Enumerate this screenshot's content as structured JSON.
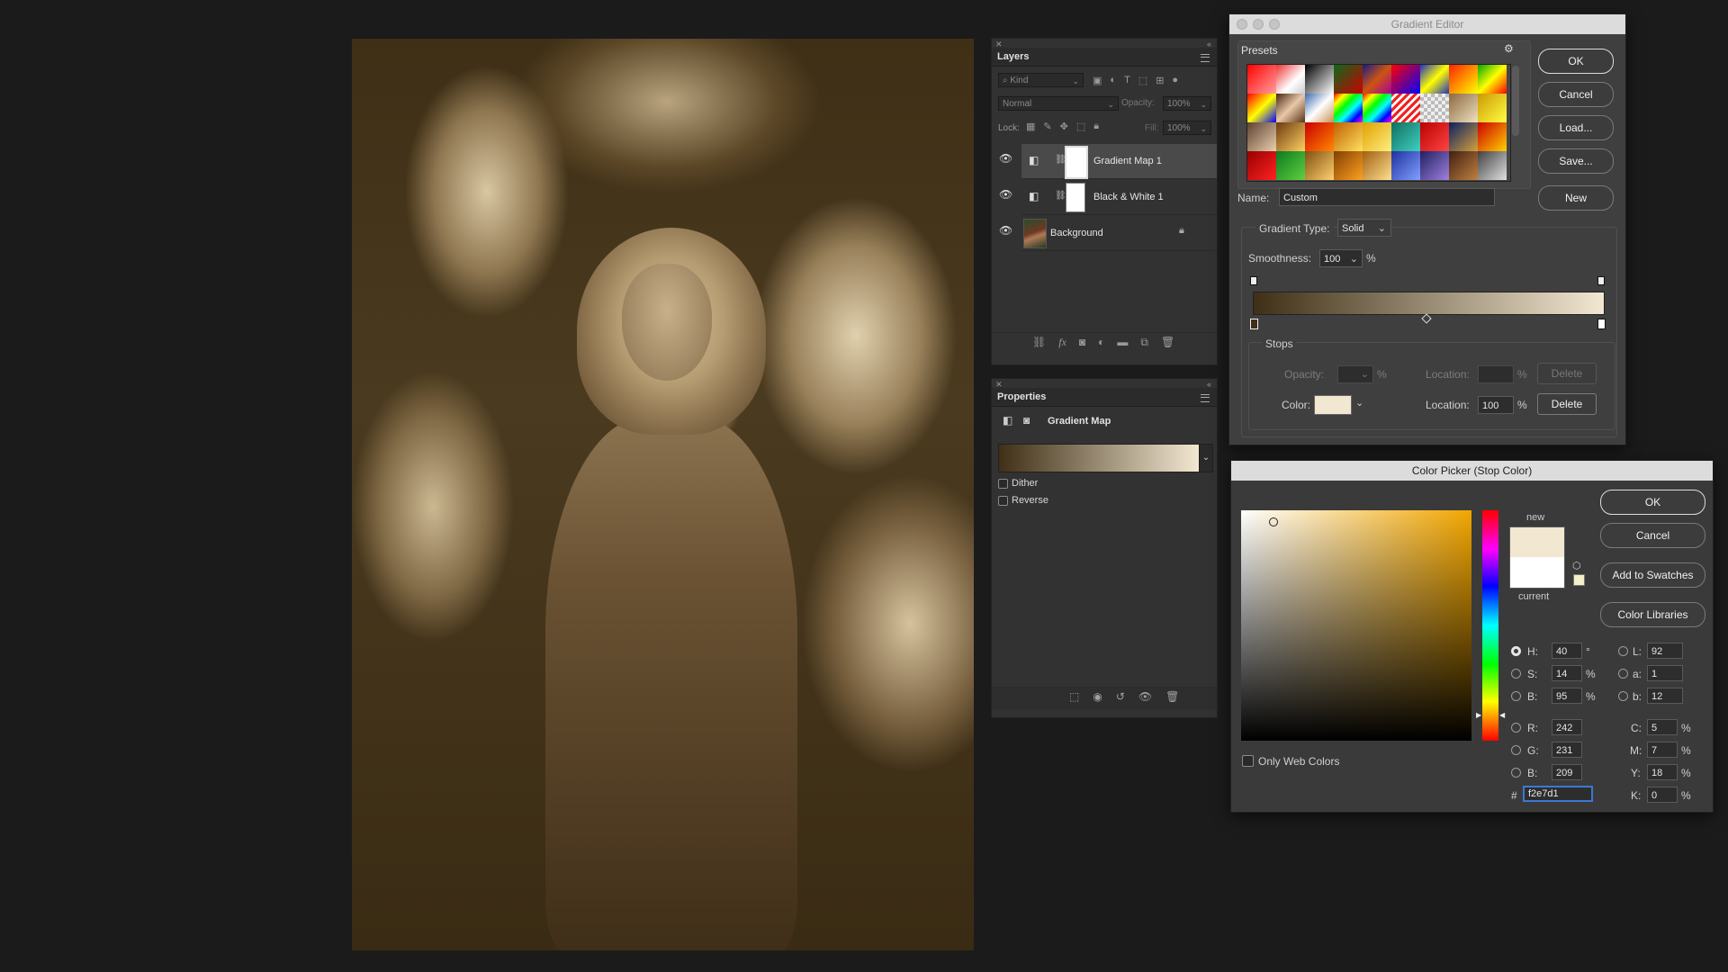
{
  "layers_panel": {
    "title": "Layers",
    "kind_label": "Kind",
    "blend_mode": "Normal",
    "opacity_label": "Opacity:",
    "opacity_value": "100%",
    "lock_label": "Lock:",
    "fill_label": "Fill:",
    "fill_value": "100%",
    "layers": [
      {
        "name": "Gradient Map 1",
        "selected": true
      },
      {
        "name": "Black & White 1",
        "selected": false
      },
      {
        "name": "Background",
        "selected": false
      }
    ],
    "footer_icons": [
      "link-icon",
      "fx-icon",
      "mask-icon",
      "adjustment-icon",
      "folder-icon",
      "new-layer-icon",
      "trash-icon"
    ]
  },
  "properties_panel": {
    "title": "Properties",
    "adjustment_title": "Gradient Map",
    "dither_label": "Dither",
    "reverse_label": "Reverse",
    "gradient_start": "#3f2f16",
    "gradient_end": "#f2e7d1"
  },
  "gradient_editor": {
    "window_title": "Gradient Editor",
    "presets_label": "Presets",
    "buttons": {
      "ok": "OK",
      "cancel": "Cancel",
      "load": "Load...",
      "save": "Save...",
      "new": "New"
    },
    "name_label": "Name:",
    "name_value": "Custom",
    "gradient_type_label": "Gradient Type:",
    "gradient_type_value": "Solid",
    "smoothness_label": "Smoothness:",
    "smoothness_value": "100",
    "percent": "%",
    "stops_label": "Stops",
    "opacity_label": "Opacity:",
    "location_label": "Location:",
    "color_label": "Color:",
    "location_value": "100",
    "delete_label": "Delete",
    "stop_color": "#f2e7d1",
    "gradient_start": "#3f2f16",
    "gradient_end": "#f2e7d1"
  },
  "color_picker": {
    "window_title": "Color Picker (Stop Color)",
    "buttons": {
      "ok": "OK",
      "cancel": "Cancel",
      "add_swatches": "Add to Swatches",
      "libraries": "Color Libraries"
    },
    "new_label": "new",
    "current_label": "current",
    "new_color": "#f2e7d1",
    "current_color": "#ffffff",
    "only_web_label": "Only Web Colors",
    "hsb": {
      "h_label": "H:",
      "h": "40",
      "h_unit": "°",
      "s_label": "S:",
      "s": "14",
      "s_unit": "%",
      "b_label": "B:",
      "b": "95",
      "b_unit": "%"
    },
    "rgb": {
      "r_label": "R:",
      "r": "242",
      "g_label": "G:",
      "g": "231",
      "b_label": "B:",
      "b": "209"
    },
    "lab": {
      "l_label": "L:",
      "l": "92",
      "a_label": "a:",
      "a": "1",
      "b_label": "b:",
      "b": "12"
    },
    "cmyk": {
      "c_label": "C:",
      "c": "5",
      "m_label": "M:",
      "m": "7",
      "y_label": "Y:",
      "y": "18",
      "k_label": "K:",
      "k": "0",
      "unit": "%"
    },
    "hex_label": "#",
    "hex_value": "f2e7d1"
  }
}
